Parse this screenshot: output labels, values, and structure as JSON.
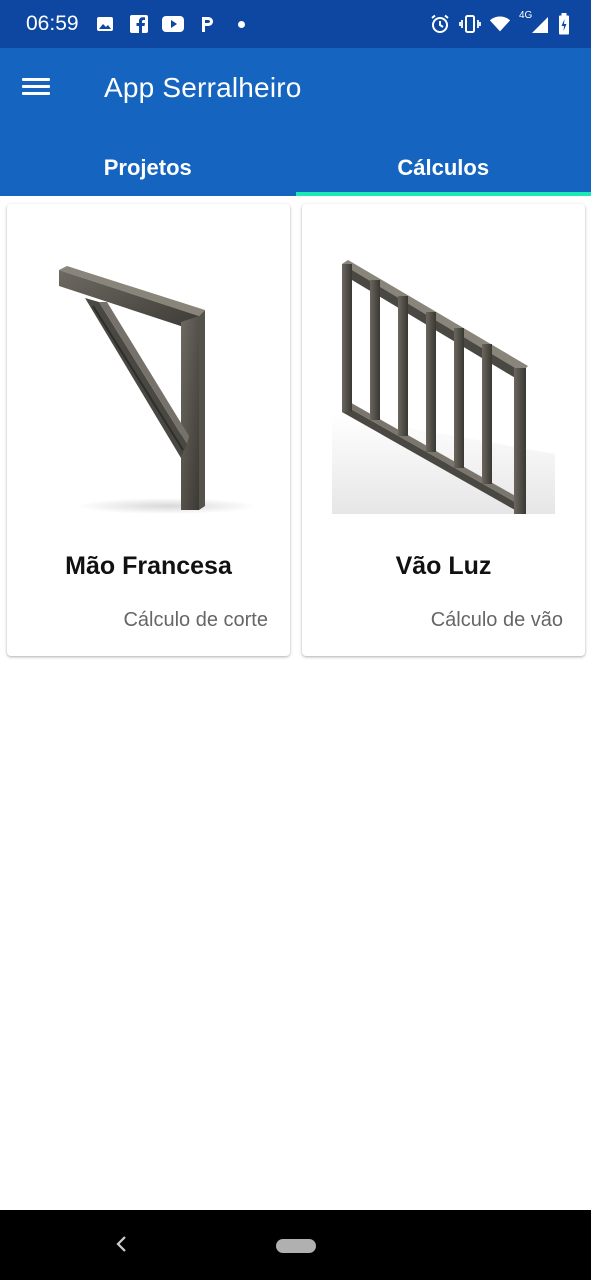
{
  "status_bar": {
    "time": "06:59",
    "network": "4G",
    "icons_left": [
      "gallery-icon",
      "facebook-icon",
      "youtube-icon",
      "p-icon",
      "dot-icon"
    ],
    "icons_right": [
      "alarm-icon",
      "vibrate-icon",
      "wifi-icon",
      "signal-icon",
      "battery-icon"
    ]
  },
  "app_bar": {
    "title": "App Serralheiro",
    "color": "#1565c0"
  },
  "tabs": [
    {
      "label": "Projetos",
      "active": false
    },
    {
      "label": "Cálculos",
      "active": true
    }
  ],
  "tab_indicator_color": "#1de9b6",
  "cards": [
    {
      "title": "Mão Francesa",
      "subtitle": "Cálculo de corte",
      "image": "mao-francesa-bracket"
    },
    {
      "title": "Vão Luz",
      "subtitle": "Cálculo de vão",
      "image": "vao-luz-railing"
    }
  ]
}
